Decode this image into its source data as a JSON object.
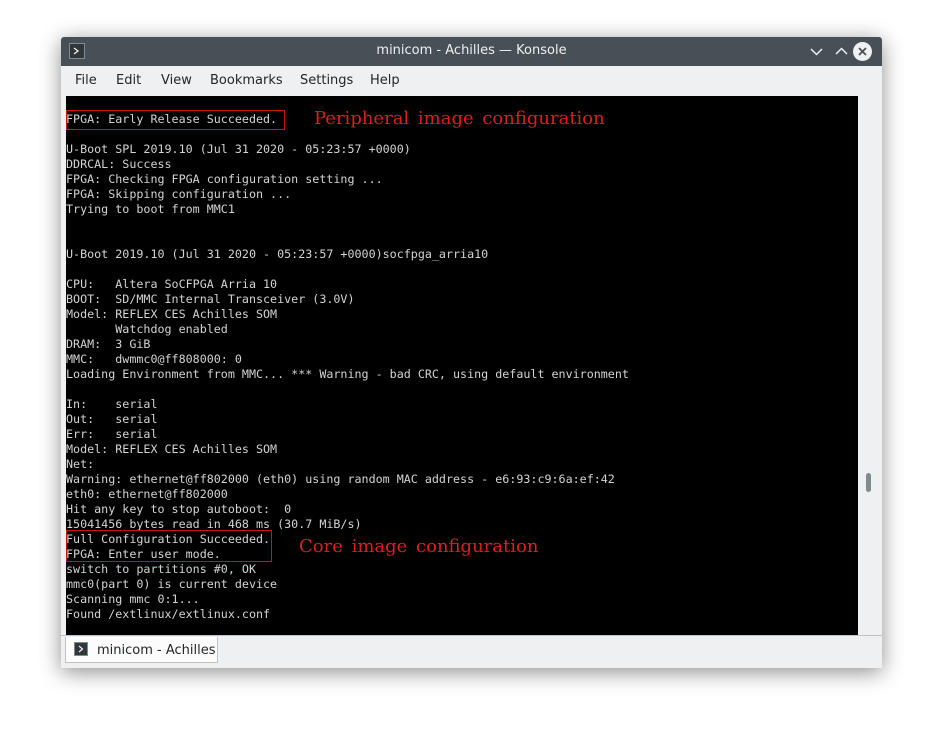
{
  "window": {
    "title": "minicom - Achilles — Konsole"
  },
  "menu": [
    {
      "label": "File"
    },
    {
      "label": "Edit"
    },
    {
      "label": "View"
    },
    {
      "label": "Bookmarks"
    },
    {
      "label": "Settings"
    },
    {
      "label": "Help"
    }
  ],
  "terminal": {
    "lines": [
      "FPGA: Early Release Succeeded.",
      "",
      "U-Boot SPL 2019.10 (Jul 31 2020 - 05:23:57 +0000)",
      "DDRCAL: Success",
      "FPGA: Checking FPGA configuration setting ...",
      "FPGA: Skipping configuration ...",
      "Trying to boot from MMC1",
      "",
      "",
      "U-Boot 2019.10 (Jul 31 2020 - 05:23:57 +0000)socfpga_arria10",
      "",
      "CPU:   Altera SoCFPGA Arria 10",
      "BOOT:  SD/MMC Internal Transceiver (3.0V)",
      "Model: REFLEX CES Achilles SOM",
      "       Watchdog enabled",
      "DRAM:  3 GiB",
      "MMC:   dwmmc0@ff808000: 0",
      "Loading Environment from MMC... *** Warning - bad CRC, using default environment",
      "",
      "In:    serial",
      "Out:   serial",
      "Err:   serial",
      "Model: REFLEX CES Achilles SOM",
      "Net:   ",
      "Warning: ethernet@ff802000 (eth0) using random MAC address - e6:93:c9:6a:ef:42",
      "eth0: ethernet@ff802000",
      "Hit any key to stop autoboot:  0",
      "15041456 bytes read in 468 ms (30.7 MiB/s)",
      "Full Configuration Succeeded.",
      "FPGA: Enter user mode.",
      "switch to partitions #0, OK",
      "mmc0(part 0) is current device",
      "Scanning mmc 0:1...",
      "Found /extlinux/extlinux.conf"
    ],
    "text_color": "#d3d3d3",
    "background": "#000000"
  },
  "annotations": {
    "peripheral_label": "Peripheral image configuration",
    "core_label": "Core image configuration",
    "color": "#dd1e1e"
  },
  "tabs": [
    {
      "label": "minicom - Achilles"
    }
  ],
  "icons": {
    "app": "terminal-icon",
    "minimize": "chevron-down-icon",
    "maximize": "chevron-up-icon",
    "close": "close-icon"
  }
}
